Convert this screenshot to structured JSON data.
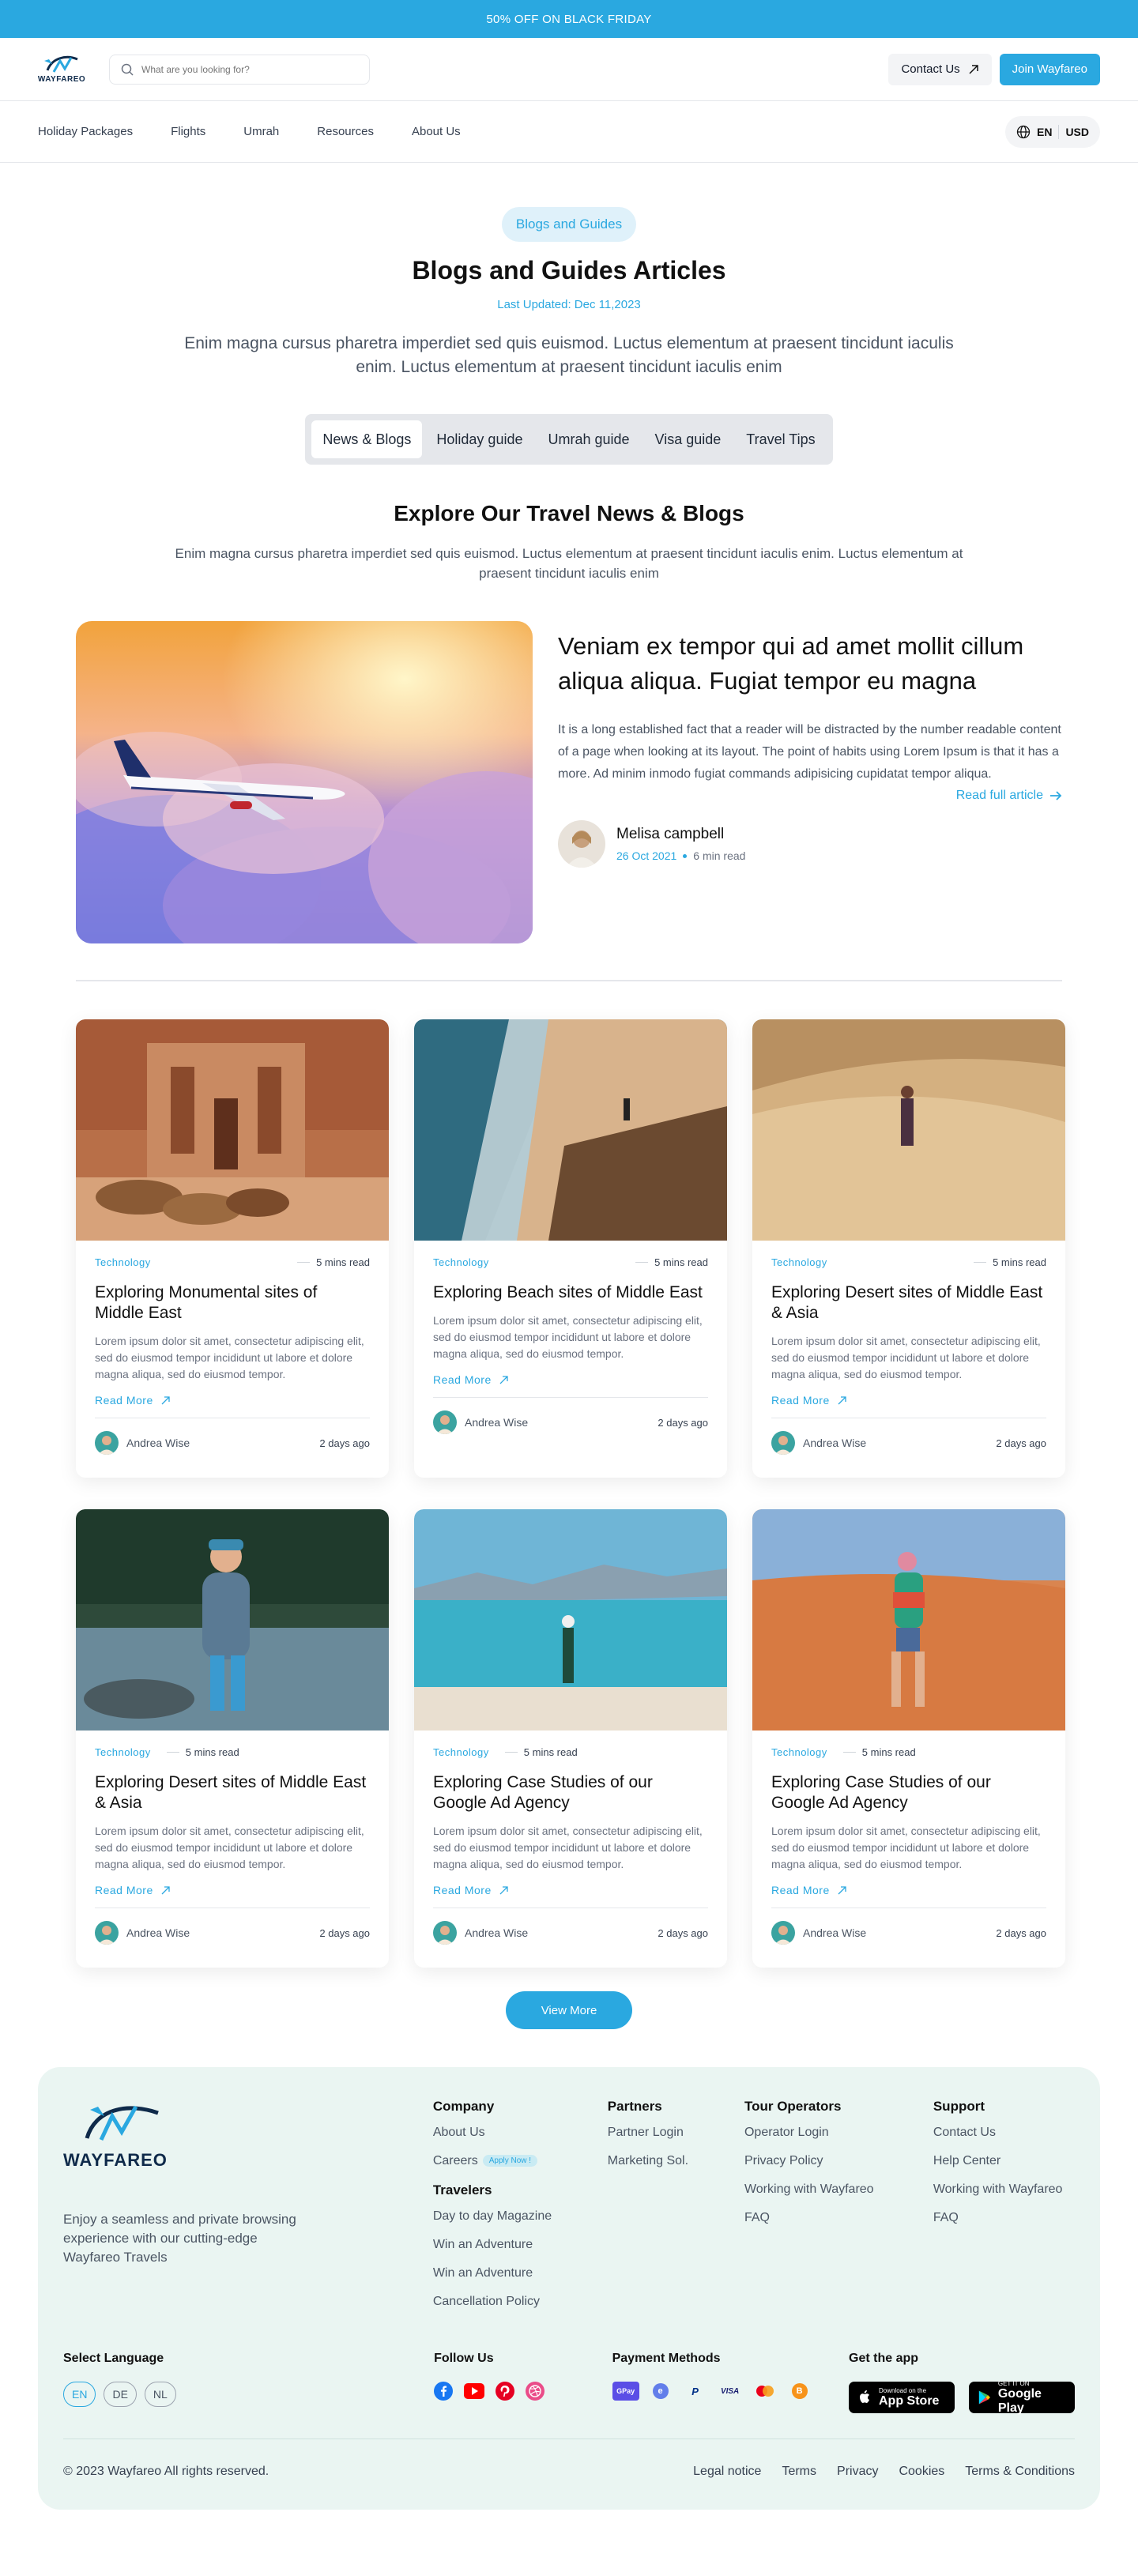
{
  "topbar": {
    "promo": "50% OFF ON BLACK FRIDAY"
  },
  "header": {
    "logo": "WAYFAREO",
    "search_placeholder": "What are you looking for?",
    "contact": "Contact Us",
    "join": "Join Wayfareo"
  },
  "nav": {
    "items": [
      "Holiday Packages",
      "Flights",
      "Umrah",
      "Resources",
      "About Us"
    ],
    "lang": "EN",
    "currency": "USD"
  },
  "hero": {
    "pill": "Blogs and Guides",
    "title": "Blogs and Guides Articles",
    "updated": "Last Updated: Dec 11,2023",
    "lead": "Enim magna cursus pharetra imperdiet sed quis euismod. Luctus elementum at praesent tincidunt iaculis enim. Luctus elementum at praesent tincidunt iaculis enim",
    "tabs": [
      "News & Blogs",
      "Holiday guide",
      "Umrah guide",
      "Visa guide",
      "Travel Tips"
    ]
  },
  "section": {
    "title": "Explore Our Travel News & Blogs",
    "subtitle": "Enim magna cursus pharetra imperdiet sed quis euismod. Luctus elementum at praesent tincidunt iaculis enim. Luctus elementum at praesent tincidunt iaculis enim"
  },
  "featured": {
    "title": "Veniam ex tempor qui ad amet mollit cillum aliqua aliqua. Fugiat tempor eu magna",
    "text": "It is a long established fact that a reader will be distracted by the number readable content of a page when looking at its layout. The point of habits using Lorem Ipsum is that it has a more. Ad minim inmodo fugiat commands adipisicing cupidatat tempor aliqua.",
    "read_full": "Read full article",
    "author": "Melisa campbell",
    "date": "26 Oct 2021",
    "read_time": "6 min read"
  },
  "cards": [
    {
      "category": "Technology",
      "read": "5 mins read",
      "title": "Exploring Monumental sites of Middle East",
      "text": "Lorem ipsum dolor sit amet, consectetur adipiscing elit, sed do eiusmod tempor incididunt ut labore et dolore magna aliqua, sed do eiusmod tempor.",
      "link": "Read More",
      "author": "Andrea Wise",
      "ago": "2 days ago"
    },
    {
      "category": "Technology",
      "read": "5 mins read",
      "title": "Exploring Beach sites of Middle East",
      "text": "Lorem ipsum dolor sit amet, consectetur adipiscing elit, sed do eiusmod tempor incididunt ut labore et dolore magna aliqua, sed do eiusmod tempor.",
      "link": "Read More",
      "author": "Andrea Wise",
      "ago": "2 days ago"
    },
    {
      "category": "Technology",
      "read": "5 mins read",
      "title": "Exploring Desert sites of Middle East & Asia",
      "text": "Lorem ipsum dolor sit amet, consectetur adipiscing elit, sed do eiusmod tempor incididunt ut labore et dolore magna aliqua, sed do eiusmod tempor.",
      "link": "Read More",
      "author": "Andrea Wise",
      "ago": "2 days ago"
    },
    {
      "category": "Technology",
      "read": "5 mins read",
      "title": "Exploring Desert sites of Middle East & Asia",
      "text": "Lorem ipsum dolor sit amet, consectetur adipiscing elit, sed do eiusmod tempor incididunt ut labore et dolore magna aliqua, sed do eiusmod tempor.",
      "link": "Read More",
      "author": "Andrea Wise",
      "ago": "2 days ago"
    },
    {
      "category": "Technology",
      "read": "5 mins read",
      "title": "Exploring Case Studies of our Google Ad Agency",
      "text": "Lorem ipsum dolor sit amet, consectetur adipiscing elit, sed do eiusmod tempor incididunt ut labore et dolore magna aliqua, sed do eiusmod tempor.",
      "link": "Read More",
      "author": "Andrea Wise",
      "ago": "2 days ago"
    },
    {
      "category": "Technology",
      "read": "5 mins read",
      "title": "Exploring Case Studies of our Google Ad Agency",
      "text": "Lorem ipsum dolor sit amet, consectetur adipiscing elit, sed do eiusmod tempor incididunt ut labore et dolore magna aliqua, sed do eiusmod tempor.",
      "link": "Read More",
      "author": "Andrea Wise",
      "ago": "2 days ago"
    }
  ],
  "view_more": "View More",
  "footer": {
    "logo": "WAYFAREO",
    "desc": "Enjoy a seamless and private browsing experience with our cutting-edge Wayfareo Travels",
    "company": {
      "title": "Company",
      "about": "About Us",
      "careers": "Careers",
      "apply": "Apply Now !"
    },
    "travelers": {
      "title": "Travelers",
      "items": [
        "Day to day Magazine",
        "Win an Adventure",
        "Win an Adventure",
        "Cancellation Policy"
      ]
    },
    "partners": {
      "title": "Partners",
      "items": [
        "Partner Login",
        "Marketing Sol."
      ]
    },
    "tour": {
      "title": "Tour Operators",
      "items": [
        "Operator Login",
        "Privacy Policy",
        "Working with Wayfareo",
        "FAQ"
      ]
    },
    "support": {
      "title": "Support",
      "items": [
        "Contact Us",
        "Help Center",
        "Working with Wayfareo",
        "FAQ"
      ]
    },
    "select_language": "Select Language",
    "languages": [
      "EN",
      "DE",
      "NL"
    ],
    "follow_us": "Follow Us",
    "payment_methods": "Payment Methods",
    "payments": [
      "GPay",
      "e",
      "P",
      "VISA",
      "MC",
      "B"
    ],
    "get_app": "Get the app",
    "appstore": {
      "small": "Download on the",
      "big": "App Store"
    },
    "googleplay": {
      "small": "GET IT ON",
      "big": "Google Play"
    },
    "copyright": "© 2023 Wayfareo All rights reserved.",
    "legal": [
      "Legal notice",
      "Terms",
      "Privacy",
      "Cookies",
      "Terms & Conditions"
    ]
  },
  "colors": {
    "accent": "#2aa8e0",
    "footer_bg": "#eaf5f2"
  }
}
